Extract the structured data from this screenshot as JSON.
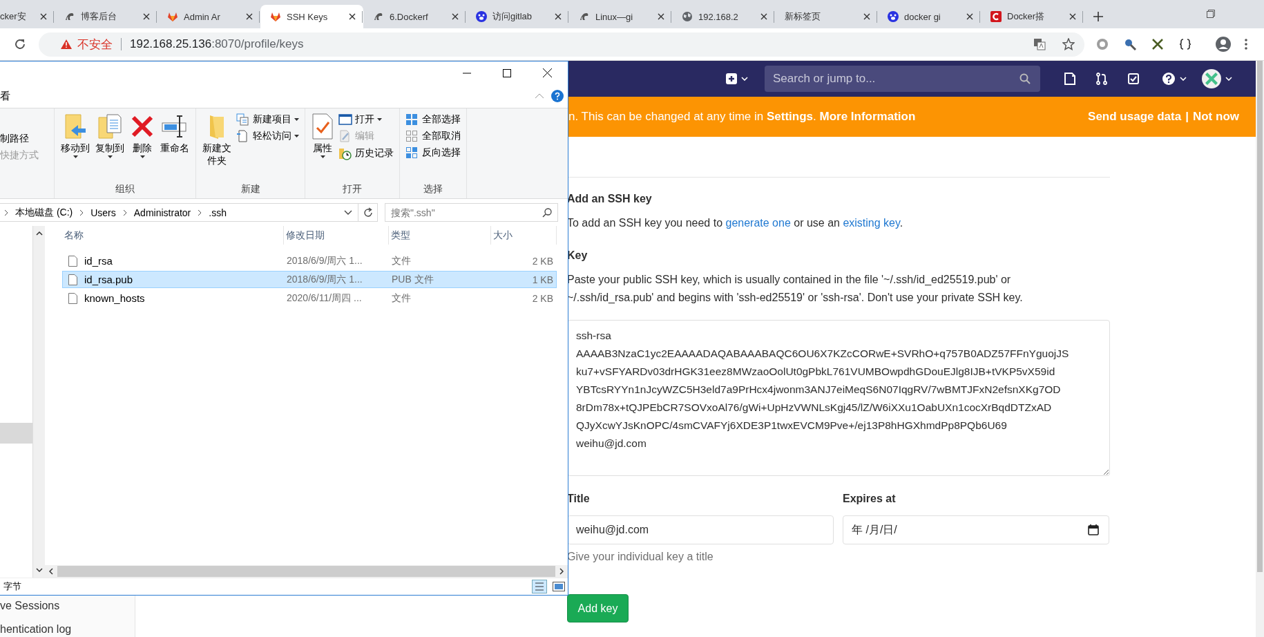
{
  "browser": {
    "tabs": [
      {
        "title": "cker安",
        "kind": "none",
        "selected": false
      },
      {
        "title": "博客后台",
        "kind": "bird",
        "selected": false
      },
      {
        "title": "Admin Ar",
        "kind": "fox",
        "selected": false
      },
      {
        "title": "SSH Keys",
        "kind": "fox",
        "selected": true
      },
      {
        "title": "6.Dockerf",
        "kind": "bird",
        "selected": false
      },
      {
        "title": "访问gitlab",
        "kind": "paw",
        "selected": false
      },
      {
        "title": "Linux—gi",
        "kind": "bird",
        "selected": false
      },
      {
        "title": "192.168.2",
        "kind": "globe",
        "selected": false
      },
      {
        "title": "新标签页",
        "kind": "none",
        "selected": false
      },
      {
        "title": "docker gi",
        "kind": "paw",
        "selected": false
      },
      {
        "title": "Docker搭",
        "kind": "brand",
        "selected": false
      }
    ],
    "address": {
      "security_label": "不安全",
      "host": "192.168.25.136",
      "path": ":8070/profile/keys"
    }
  },
  "gitlab": {
    "search": {
      "placeholder": "Search or jump to..."
    },
    "banner": {
      "text": "n. This can be changed at any time in **Settings**. **More Information**",
      "actions": [
        "Send usage data",
        "Not now"
      ],
      "separator": "|"
    },
    "sidebar": {
      "items": [
        "ve Sessions",
        "hentication log"
      ]
    },
    "form": {
      "heading": "Add an SSH key",
      "intro": [
        {
          "kind": "text",
          "text": "To add an SSH key you need to "
        },
        {
          "kind": "link",
          "text": "generate one"
        },
        {
          "kind": "text",
          "text": " or use an "
        },
        {
          "kind": "link",
          "text": "existing key"
        },
        {
          "kind": "text",
          "text": "."
        }
      ],
      "key_label": "Key",
      "key_help": "Paste your public SSH key, which is usually contained in the file '~/.ssh/id_ed25519.pub' or ~/.ssh/id_rsa.pub' and begins with 'ssh-ed25519' or 'ssh-rsa'. Don't use your private SSH key.",
      "key_value": "ssh-rsa\nAAAAB3NzaC1yc2EAAAADAQABAAABAQC6OU6X7KZcCORwE+SVRhO+q757B0ADZ57FFnYguojJS\nku7+vSFYARDv03drHGK31eez8MWzaoOolUt0gPbkL761VUMBOwpdhGDouEJlg8IJB+tVKP5vX59id\nYBTcsRYYn1nJcyWZC5H3eld7a9PrHcx4jwonm3ANJ7eiMeqS6N07IqgRV/7wBMTJFxN2efsnXKg7OD\n8rDm78x+tQJPEbCR7SOVxoAl76/gWi+UpHzVWNLsKgj45/lZ/W6iXXu1OabUXn1cocXrBqdDTZxAD\nQJyXcwYJsKnOPC/4smCVAFYj6XDE3P1twxEVCM9Pve+/ej13P8hHGXhmdPp8PQb6U69\nweihu@jd.com",
      "title_label": "Title",
      "title_value": "weihu@jd.com",
      "title_help": "Give your individual key a title",
      "expires_label": "Expires at",
      "expires_value": "年 /月/日/",
      "submit": "Add key"
    }
  },
  "explorer": {
    "ribbon": {
      "tab": "看",
      "clipboard": [
        {
          "label": "制路径",
          "disabled": false
        },
        {
          "label": "快捷方式",
          "disabled": true
        }
      ],
      "groups": [
        {
          "label": "组织",
          "items": [
            {
              "kind": "big",
              "label": "移动到",
              "menu": true,
              "disabled": false
            },
            {
              "kind": "big",
              "label": "复制到",
              "menu": true,
              "disabled": false
            },
            {
              "kind": "big",
              "label": "删除",
              "menu": true,
              "disabled": false
            },
            {
              "kind": "big",
              "label": "重命名",
              "menu": false,
              "disabled": false
            }
          ]
        },
        {
          "label": "新建",
          "items": [
            {
              "kind": "big",
              "label": "新建文件夹",
              "menu": false,
              "disabled": false
            },
            {
              "kind": "small",
              "label": "新建项目",
              "menu": true,
              "disabled": false
            },
            {
              "kind": "small",
              "label": "轻松访问",
              "menu": true,
              "disabled": false
            }
          ]
        },
        {
          "label": "打开",
          "items": [
            {
              "kind": "big",
              "label": "属性",
              "menu": true,
              "disabled": false
            },
            {
              "kind": "small",
              "label": "打开",
              "menu": true,
              "disabled": false
            },
            {
              "kind": "small",
              "label": "编辑",
              "menu": false,
              "disabled": true
            },
            {
              "kind": "small",
              "label": "历史记录",
              "menu": false,
              "disabled": false
            }
          ]
        },
        {
          "label": "选择",
          "items": [
            {
              "kind": "small",
              "label": "全部选择",
              "menu": false,
              "disabled": false
            },
            {
              "kind": "small",
              "label": "全部取消",
              "menu": false,
              "disabled": false
            },
            {
              "kind": "small",
              "label": "反向选择",
              "menu": false,
              "disabled": false
            }
          ]
        }
      ]
    },
    "breadcrumb": [
      "本地磁盘 (C:)",
      "Users",
      "Administrator",
      ".ssh"
    ],
    "search": {
      "placeholder": "搜索\".ssh\""
    },
    "columns": [
      "名称",
      "修改日期",
      "类型",
      "大小"
    ],
    "rows": [
      {
        "name": "id_rsa",
        "modified": "2018/6/9/周六 1...",
        "type": "文件",
        "size": "2 KB",
        "selected": false
      },
      {
        "name": "id_rsa.pub",
        "modified": "2018/6/9/周六 1...",
        "type": "PUB 文件",
        "size": "1 KB",
        "selected": true
      },
      {
        "name": "known_hosts",
        "modified": "2020/6/11/周四 ...",
        "type": "文件",
        "size": "2 KB",
        "selected": false
      }
    ],
    "status": "字节"
  }
}
